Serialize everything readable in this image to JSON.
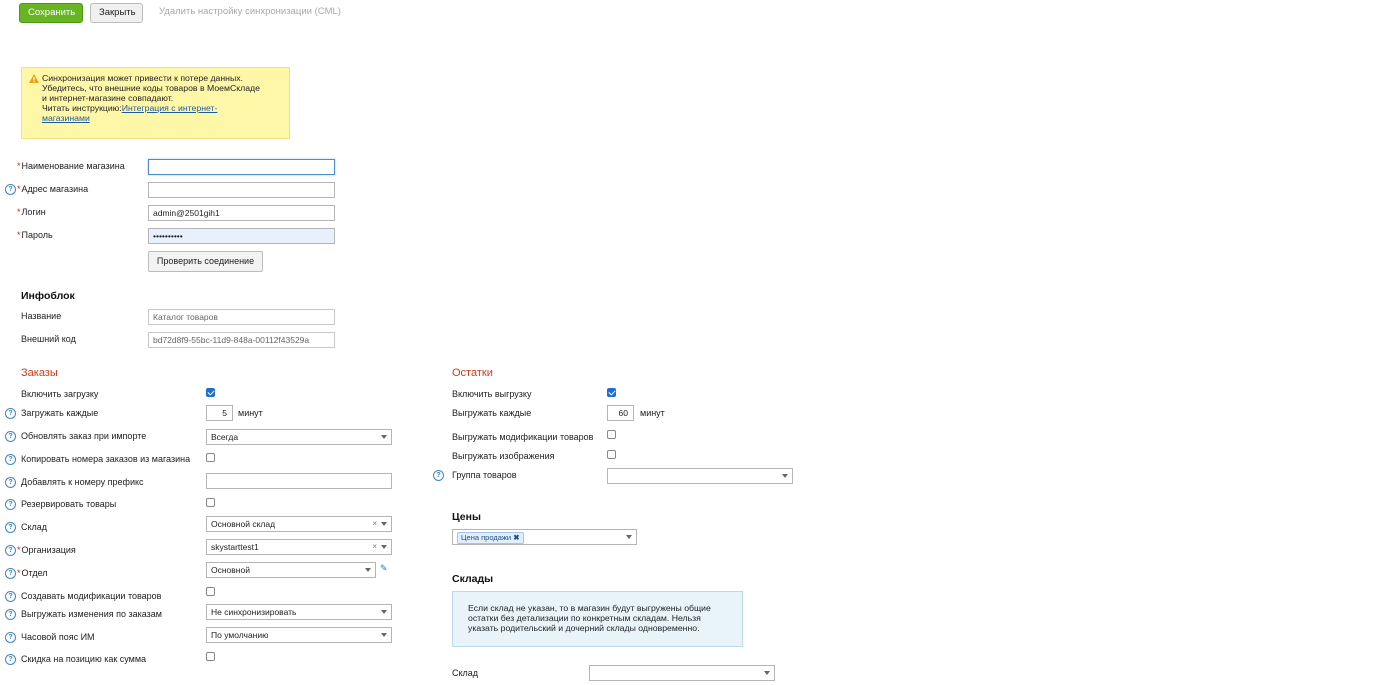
{
  "toolbar": {
    "save_label": "Сохранить",
    "close_label": "Закрыть",
    "delete_label": "Удалить настройку синхронизации (CML)"
  },
  "warning": {
    "line1": "Синхронизация может привести к потере данных.",
    "line2": "Убедитесь, что внешние коды товаров в МоемСкладе",
    "line3": "и интернет-магазине совпадают.",
    "line4": "Читать инструкцию:",
    "link1": "Интеграция с интернет-",
    "link2": "магазинами"
  },
  "store": {
    "name_label": "Наименование магазина",
    "name_value": "",
    "address_label": "Адрес магазина",
    "address_value": "",
    "login_label": "Логин",
    "login_value": "admin@2501gih1",
    "password_label": "Пароль",
    "password_value": "••••••••••",
    "check_button": "Проверить соединение"
  },
  "infoblock": {
    "title": "Инфоблок",
    "name_label": "Название",
    "name_value": "Каталог товаров",
    "code_label": "Внешний код",
    "code_value": "bd72d8f9-55bc-11d9-848a-00112f43529a"
  },
  "orders": {
    "title": "Заказы",
    "enable_label": "Включить загрузку",
    "enable_checked": true,
    "interval_label": "Загружать каждые",
    "interval_value": "5",
    "interval_unit": "минут",
    "update_label": "Обновлять заказ при импорте",
    "update_value": "Всегда",
    "copy_numbers_label": "Копировать номера заказов из магазина",
    "prefix_label": "Добавлять к номеру префикс",
    "prefix_value": "",
    "reserve_label": "Резервировать товары",
    "warehouse_label": "Склад",
    "warehouse_value": "Основной склад",
    "org_label": "Организация",
    "org_value": "skystarttest1",
    "dept_label": "Отдел",
    "dept_value": "Основной",
    "create_mods_label": "Создавать модификации товаров",
    "export_changes_label": "Выгружать изменения по заказам",
    "export_changes_value": "Не синхронизировать",
    "timezone_label": "Часовой пояс ИМ",
    "timezone_value": "По умолчанию",
    "discount_label": "Скидка на позицию как сумма"
  },
  "stock": {
    "title": "Остатки",
    "enable_label": "Включить выгрузку",
    "enable_checked": true,
    "interval_label": "Выгружать каждые",
    "interval_value": "60",
    "interval_unit": "минут",
    "mods_label": "Выгружать модификации товаров",
    "images_label": "Выгружать изображения",
    "group_label": "Группа товаров",
    "group_value": ""
  },
  "prices": {
    "title": "Цены",
    "tag": "Цена продажи"
  },
  "warehouses": {
    "title": "Склады",
    "info1": "Если склад не указан, то в магазин будут выгружены общие",
    "info2": "остатки без детализации по конкретным складам. Нельзя",
    "info3": "указать родительский и дочерний склады одновременно.",
    "warehouse_label": "Склад",
    "warehouse_value": ""
  },
  "colors": {
    "save_green": "#67b521",
    "required_red": "#d9261c",
    "section_red": "#d23a1a",
    "help_blue": "#3d86c6",
    "warning_bg": "#fff7a8",
    "info_bg": "#e9f4fa"
  },
  "icons": {
    "warning": "warning-triangle-icon",
    "help": "question-circle-icon",
    "dropdown": "chevron-down-icon",
    "clear": "close-icon",
    "edit": "pencil-icon",
    "tag_remove": "close-icon"
  }
}
